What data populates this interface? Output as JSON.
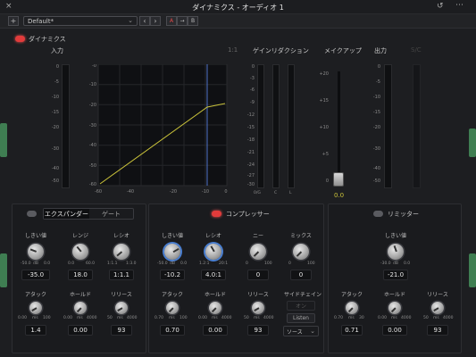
{
  "window": {
    "title": "ダイナミクス - オーディオ 1"
  },
  "toolbar": {
    "add": "+",
    "preset": "Default*",
    "prev": "‹",
    "next": "›",
    "a": "A",
    "arrow": "→",
    "b": "B"
  },
  "dynamics": {
    "label": "ダイナミクス"
  },
  "sections": {
    "input": "入力",
    "ratio_hint": "1:1",
    "gain_reduction": "ゲインリダクション",
    "makeup": "メイクアップ",
    "output": "出力",
    "sc": "S/C"
  },
  "meter_ticks": [
    "0",
    "-5",
    "-10",
    "-15",
    "-20",
    "-30",
    "-40",
    "-50"
  ],
  "gr_ticks": [
    "0",
    "-3",
    "-6",
    "-9",
    "-12",
    "-15",
    "-18",
    "-21",
    "-24",
    "-27",
    "-30"
  ],
  "gr_labels": [
    "0/G",
    "C",
    "L"
  ],
  "makeup_ticks": [
    "+20",
    "+15",
    "+10",
    "+5",
    "0"
  ],
  "makeup_value": "0.0",
  "graph": {
    "x_ticks": [
      "-60",
      "-40",
      "-20",
      "-10",
      "0"
    ],
    "y_ticks": [
      "-0",
      "-10",
      "-20",
      "-30",
      "-40",
      "-50",
      "-60"
    ]
  },
  "expander": {
    "tab1": "エクスパンダー",
    "tab2": "ゲート",
    "k1": {
      "label": "しきい値",
      "min": "-50.0",
      "unit": "dB",
      "max": "0.0",
      "value": "-35.0"
    },
    "k2": {
      "label": "レンジ",
      "min": "0.0",
      "max": "60.0",
      "value": "18.0"
    },
    "k3": {
      "label": "レシオ",
      "min": "1:1.1",
      "max": "1:3.0",
      "value": "1:1.1"
    },
    "k4": {
      "label": "アタック",
      "min": "0.00",
      "unit": "ms",
      "max": "100",
      "value": "1.4"
    },
    "k5": {
      "label": "ホールド",
      "min": "0.00",
      "unit": "ms",
      "max": "4000",
      "value": "0.00"
    },
    "k6": {
      "label": "リリース",
      "min": "50",
      "unit": "ms",
      "max": "4000",
      "value": "93"
    }
  },
  "compressor": {
    "title": "コンプレッサー",
    "k1": {
      "label": "しきい値",
      "min": "-50.0",
      "unit": "dB",
      "max": "0.0",
      "value": "-10.2"
    },
    "k2": {
      "label": "レシオ",
      "min": "1.2:1",
      "max": "20:1",
      "value": "4.0:1"
    },
    "k3": {
      "label": "ニー",
      "min": "0",
      "max": "100",
      "value": "0"
    },
    "k4": {
      "label": "ミックス",
      "min": "0",
      "max": "100",
      "value": "0"
    },
    "k5": {
      "label": "アタック",
      "min": "0.70",
      "unit": "ms",
      "max": "100",
      "value": "0.70"
    },
    "k6": {
      "label": "ホールド",
      "min": "0.00",
      "unit": "ms",
      "max": "4000",
      "value": "0.00"
    },
    "k7": {
      "label": "リリース",
      "min": "50",
      "unit": "ms",
      "max": "4000",
      "value": "93"
    },
    "sidechain": "サイドチェイン",
    "sc_on": "オン",
    "listen": "Listen",
    "source": "ソース"
  },
  "limiter": {
    "title": "リミッター",
    "k1": {
      "label": "しきい値",
      "min": "-30.0",
      "unit": "dB",
      "max": "0.0",
      "value": "-21.0"
    },
    "k2": {
      "label": "アタック",
      "min": "0.70",
      "unit": "ms",
      "max": "30",
      "value": "0.71"
    },
    "k3": {
      "label": "ホールド",
      "min": "0.00",
      "unit": "ms",
      "max": "4000",
      "value": "0.00"
    },
    "k4": {
      "label": "リリース",
      "min": "50",
      "unit": "ms",
      "max": "4000",
      "value": "93"
    }
  }
}
